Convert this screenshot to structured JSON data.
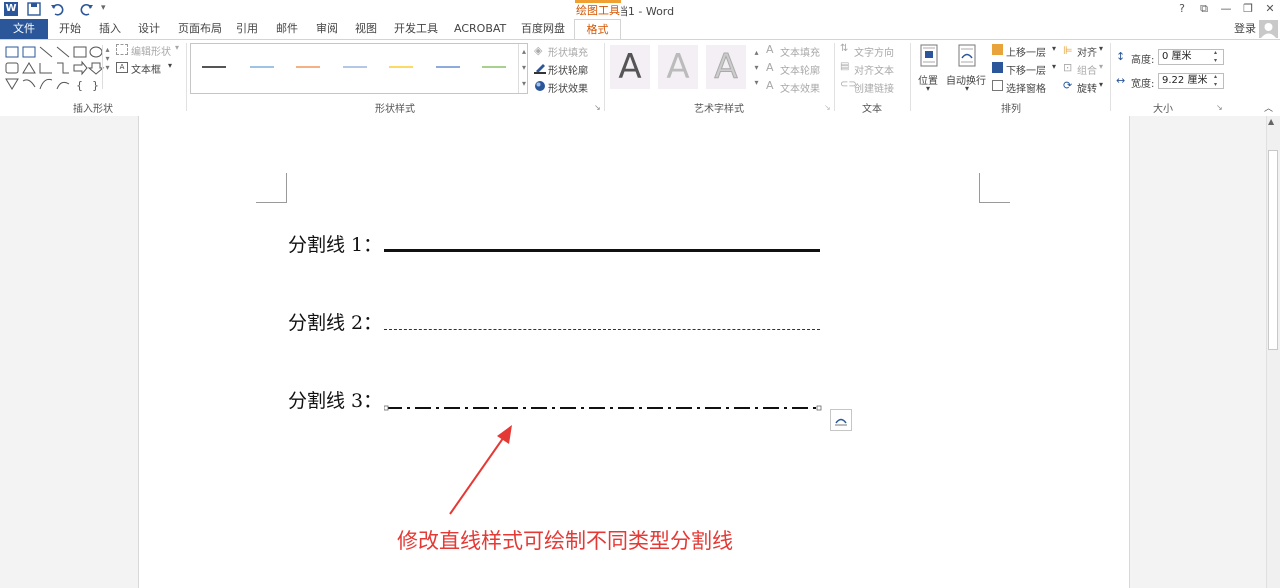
{
  "window": {
    "title": "文档1 - Word",
    "context_tab": "绘图工具",
    "controls": [
      "?",
      "⧉",
      "—",
      "❐",
      "✕"
    ]
  },
  "tabs": [
    "文件",
    "开始",
    "插入",
    "设计",
    "页面布局",
    "引用",
    "邮件",
    "审阅",
    "视图",
    "开发工具",
    "ACROBAT",
    "百度网盘",
    "格式"
  ],
  "account": {
    "login": "登录"
  },
  "ribbon": {
    "insert_shapes": {
      "label": "插入形状",
      "edit_shape": "编辑形状",
      "text_box": "文本框"
    },
    "shape_styles": {
      "label": "形状样式",
      "fill": "形状填充",
      "outline": "形状轮廓",
      "effects": "形状效果",
      "swatch_colors": [
        "#555555",
        "#9dc3e6",
        "#f4b183",
        "#b4c7e7",
        "#ffd966",
        "#8faadc",
        "#a9d18e"
      ]
    },
    "wordart_styles": {
      "label": "艺术字样式",
      "text_fill": "文本填充",
      "text_outline": "文本轮廓",
      "text_effects": "文本效果",
      "sample": "A"
    },
    "text": {
      "label": "文本",
      "direction": "文字方向",
      "align": "对齐文本",
      "link": "创建链接"
    },
    "arrange": {
      "label": "排列",
      "position": "位置",
      "wrap": "自动换行",
      "forward": "上移一层",
      "backward": "下移一层",
      "pane": "选择窗格",
      "align": "对齐",
      "group": "组合",
      "rotate": "旋转"
    },
    "size": {
      "label": "大小",
      "height_label": "高度:",
      "height_value": "0 厘米",
      "width_label": "宽度:",
      "width_value": "9.22 厘米"
    }
  },
  "document": {
    "lines": [
      {
        "label": "分割线 1：",
        "style": "solid"
      },
      {
        "label": "分割线 2：",
        "style": "dashed"
      },
      {
        "label": "分割线 3：",
        "style": "dash-dot"
      }
    ],
    "annotation": "修改直线样式可绘制不同类型分割线",
    "annotation_color": "#e53935"
  }
}
